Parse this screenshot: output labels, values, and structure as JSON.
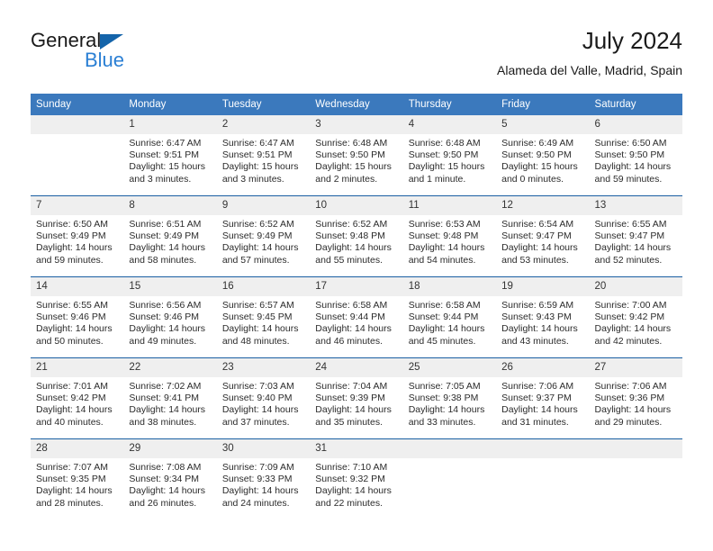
{
  "brand": {
    "name_part1": "General",
    "name_part2": "Blue",
    "triangle_color": "#1464aa",
    "blue_color": "#2a7fd4"
  },
  "header": {
    "title": "July 2024",
    "subtitle": "Alameda del Valle, Madrid, Spain"
  },
  "theme": {
    "header_bg": "#3b79bd",
    "week_separator": "#1a5fa3",
    "daynum_bg": "#efefef"
  },
  "weekdays": [
    "Sunday",
    "Monday",
    "Tuesday",
    "Wednesday",
    "Thursday",
    "Friday",
    "Saturday"
  ],
  "weeks": [
    [
      {
        "day": "",
        "sunrise": "",
        "sunset": "",
        "daylight": ""
      },
      {
        "day": "1",
        "sunrise": "Sunrise: 6:47 AM",
        "sunset": "Sunset: 9:51 PM",
        "daylight": "Daylight: 15 hours and 3 minutes."
      },
      {
        "day": "2",
        "sunrise": "Sunrise: 6:47 AM",
        "sunset": "Sunset: 9:51 PM",
        "daylight": "Daylight: 15 hours and 3 minutes."
      },
      {
        "day": "3",
        "sunrise": "Sunrise: 6:48 AM",
        "sunset": "Sunset: 9:50 PM",
        "daylight": "Daylight: 15 hours and 2 minutes."
      },
      {
        "day": "4",
        "sunrise": "Sunrise: 6:48 AM",
        "sunset": "Sunset: 9:50 PM",
        "daylight": "Daylight: 15 hours and 1 minute."
      },
      {
        "day": "5",
        "sunrise": "Sunrise: 6:49 AM",
        "sunset": "Sunset: 9:50 PM",
        "daylight": "Daylight: 15 hours and 0 minutes."
      },
      {
        "day": "6",
        "sunrise": "Sunrise: 6:50 AM",
        "sunset": "Sunset: 9:50 PM",
        "daylight": "Daylight: 14 hours and 59 minutes."
      }
    ],
    [
      {
        "day": "7",
        "sunrise": "Sunrise: 6:50 AM",
        "sunset": "Sunset: 9:49 PM",
        "daylight": "Daylight: 14 hours and 59 minutes."
      },
      {
        "day": "8",
        "sunrise": "Sunrise: 6:51 AM",
        "sunset": "Sunset: 9:49 PM",
        "daylight": "Daylight: 14 hours and 58 minutes."
      },
      {
        "day": "9",
        "sunrise": "Sunrise: 6:52 AM",
        "sunset": "Sunset: 9:49 PM",
        "daylight": "Daylight: 14 hours and 57 minutes."
      },
      {
        "day": "10",
        "sunrise": "Sunrise: 6:52 AM",
        "sunset": "Sunset: 9:48 PM",
        "daylight": "Daylight: 14 hours and 55 minutes."
      },
      {
        "day": "11",
        "sunrise": "Sunrise: 6:53 AM",
        "sunset": "Sunset: 9:48 PM",
        "daylight": "Daylight: 14 hours and 54 minutes."
      },
      {
        "day": "12",
        "sunrise": "Sunrise: 6:54 AM",
        "sunset": "Sunset: 9:47 PM",
        "daylight": "Daylight: 14 hours and 53 minutes."
      },
      {
        "day": "13",
        "sunrise": "Sunrise: 6:55 AM",
        "sunset": "Sunset: 9:47 PM",
        "daylight": "Daylight: 14 hours and 52 minutes."
      }
    ],
    [
      {
        "day": "14",
        "sunrise": "Sunrise: 6:55 AM",
        "sunset": "Sunset: 9:46 PM",
        "daylight": "Daylight: 14 hours and 50 minutes."
      },
      {
        "day": "15",
        "sunrise": "Sunrise: 6:56 AM",
        "sunset": "Sunset: 9:46 PM",
        "daylight": "Daylight: 14 hours and 49 minutes."
      },
      {
        "day": "16",
        "sunrise": "Sunrise: 6:57 AM",
        "sunset": "Sunset: 9:45 PM",
        "daylight": "Daylight: 14 hours and 48 minutes."
      },
      {
        "day": "17",
        "sunrise": "Sunrise: 6:58 AM",
        "sunset": "Sunset: 9:44 PM",
        "daylight": "Daylight: 14 hours and 46 minutes."
      },
      {
        "day": "18",
        "sunrise": "Sunrise: 6:58 AM",
        "sunset": "Sunset: 9:44 PM",
        "daylight": "Daylight: 14 hours and 45 minutes."
      },
      {
        "day": "19",
        "sunrise": "Sunrise: 6:59 AM",
        "sunset": "Sunset: 9:43 PM",
        "daylight": "Daylight: 14 hours and 43 minutes."
      },
      {
        "day": "20",
        "sunrise": "Sunrise: 7:00 AM",
        "sunset": "Sunset: 9:42 PM",
        "daylight": "Daylight: 14 hours and 42 minutes."
      }
    ],
    [
      {
        "day": "21",
        "sunrise": "Sunrise: 7:01 AM",
        "sunset": "Sunset: 9:42 PM",
        "daylight": "Daylight: 14 hours and 40 minutes."
      },
      {
        "day": "22",
        "sunrise": "Sunrise: 7:02 AM",
        "sunset": "Sunset: 9:41 PM",
        "daylight": "Daylight: 14 hours and 38 minutes."
      },
      {
        "day": "23",
        "sunrise": "Sunrise: 7:03 AM",
        "sunset": "Sunset: 9:40 PM",
        "daylight": "Daylight: 14 hours and 37 minutes."
      },
      {
        "day": "24",
        "sunrise": "Sunrise: 7:04 AM",
        "sunset": "Sunset: 9:39 PM",
        "daylight": "Daylight: 14 hours and 35 minutes."
      },
      {
        "day": "25",
        "sunrise": "Sunrise: 7:05 AM",
        "sunset": "Sunset: 9:38 PM",
        "daylight": "Daylight: 14 hours and 33 minutes."
      },
      {
        "day": "26",
        "sunrise": "Sunrise: 7:06 AM",
        "sunset": "Sunset: 9:37 PM",
        "daylight": "Daylight: 14 hours and 31 minutes."
      },
      {
        "day": "27",
        "sunrise": "Sunrise: 7:06 AM",
        "sunset": "Sunset: 9:36 PM",
        "daylight": "Daylight: 14 hours and 29 minutes."
      }
    ],
    [
      {
        "day": "28",
        "sunrise": "Sunrise: 7:07 AM",
        "sunset": "Sunset: 9:35 PM",
        "daylight": "Daylight: 14 hours and 28 minutes."
      },
      {
        "day": "29",
        "sunrise": "Sunrise: 7:08 AM",
        "sunset": "Sunset: 9:34 PM",
        "daylight": "Daylight: 14 hours and 26 minutes."
      },
      {
        "day": "30",
        "sunrise": "Sunrise: 7:09 AM",
        "sunset": "Sunset: 9:33 PM",
        "daylight": "Daylight: 14 hours and 24 minutes."
      },
      {
        "day": "31",
        "sunrise": "Sunrise: 7:10 AM",
        "sunset": "Sunset: 9:32 PM",
        "daylight": "Daylight: 14 hours and 22 minutes."
      },
      {
        "day": "",
        "sunrise": "",
        "sunset": "",
        "daylight": ""
      },
      {
        "day": "",
        "sunrise": "",
        "sunset": "",
        "daylight": ""
      },
      {
        "day": "",
        "sunrise": "",
        "sunset": "",
        "daylight": ""
      }
    ]
  ]
}
